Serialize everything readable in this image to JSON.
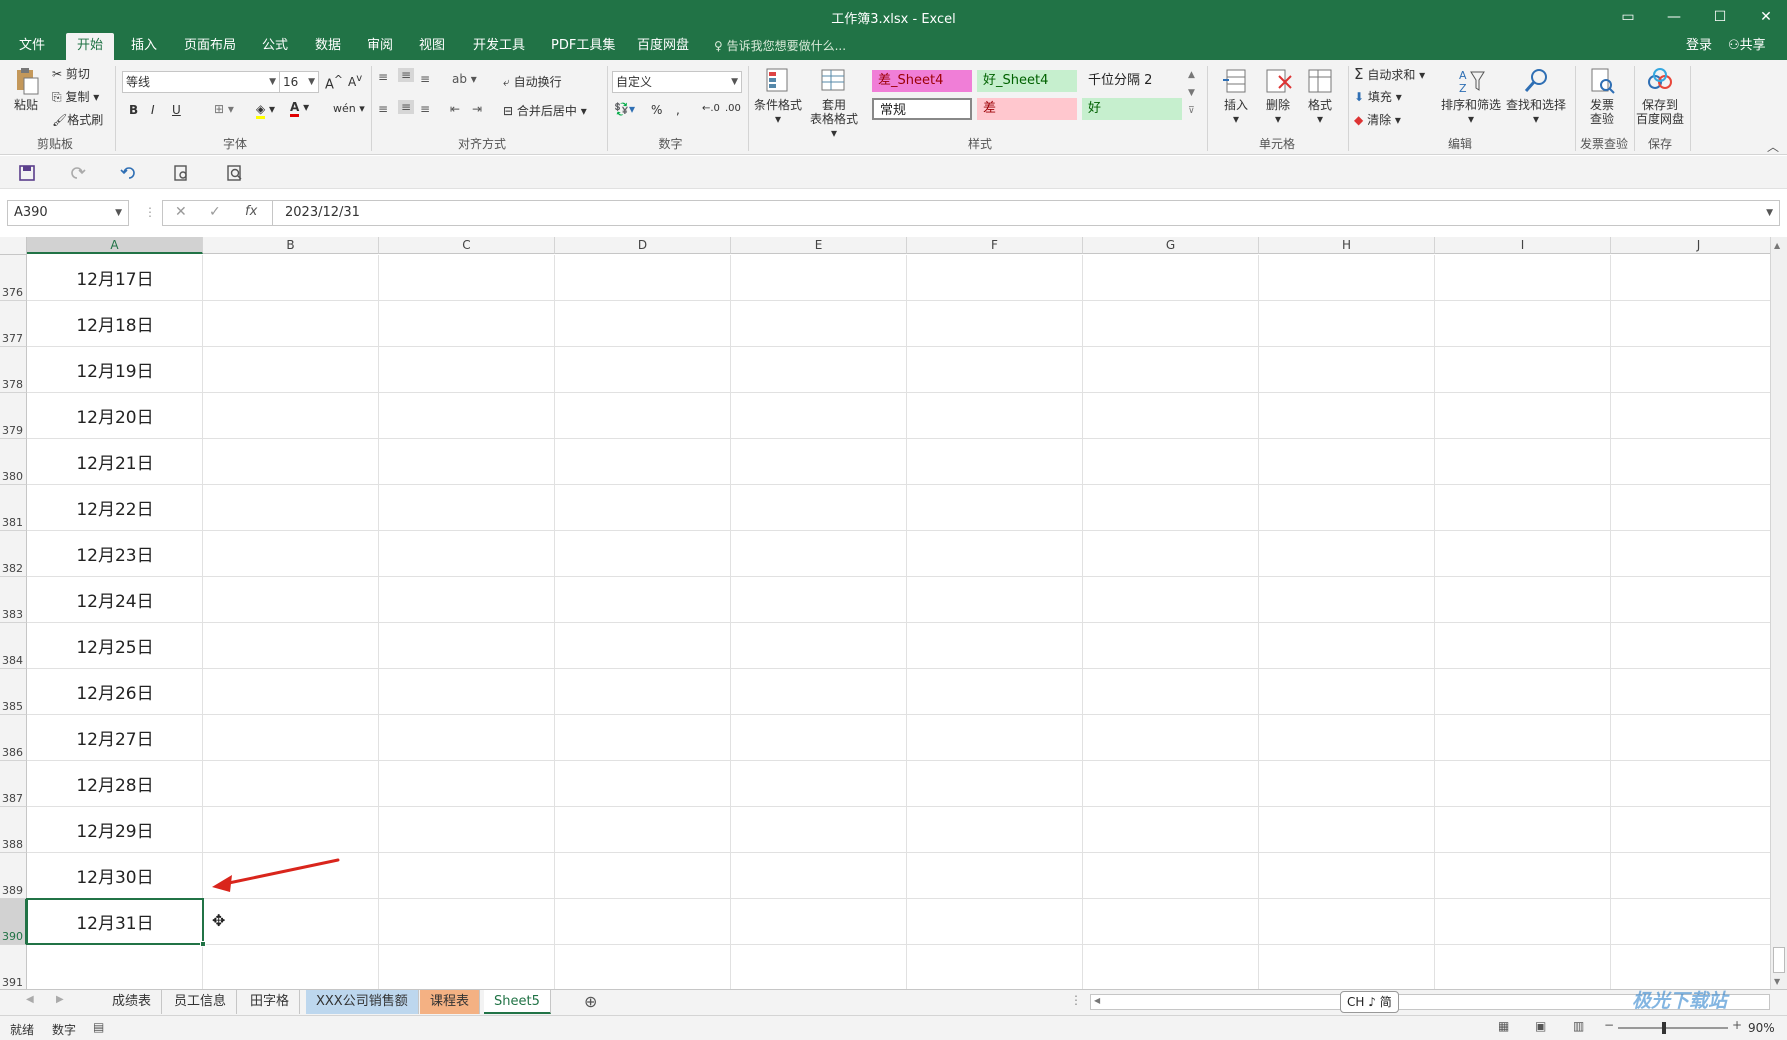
{
  "titlebar": {
    "title": "工作簿3.xlsx - Excel"
  },
  "ribbon_tabs": {
    "file": "文件",
    "home": "开始",
    "insert": "插入",
    "page_layout": "页面布局",
    "formulas": "公式",
    "data": "数据",
    "review": "审阅",
    "view": "视图",
    "developer": "开发工具",
    "pdf": "PDF工具集",
    "baidu": "百度网盘",
    "tell_me": "告诉我您想要做什么...",
    "login": "登录",
    "share": "共享"
  },
  "clipboard": {
    "paste": "粘贴",
    "cut": "剪切",
    "copy": "复制",
    "format_painter": "格式刷",
    "label": "剪贴板"
  },
  "font": {
    "name": "等线",
    "size": "16",
    "bold": "B",
    "italic": "I",
    "underline": "U",
    "label": "字体"
  },
  "alignment": {
    "wrap": "自动换行",
    "merge": "合并后居中",
    "label": "对齐方式"
  },
  "number": {
    "format": "自定义",
    "label": "数字"
  },
  "styles": {
    "conditional": "条件格式",
    "table_line1": "套用",
    "table_line2": "表格格式",
    "cells": [
      "差_Sheet4",
      "好_Sheet4",
      "千位分隔 2",
      "常规",
      "差",
      "好"
    ],
    "label": "样式"
  },
  "cells_group": {
    "insert": "插入",
    "delete": "删除",
    "format": "格式",
    "label": "单元格"
  },
  "editing": {
    "autosum": "自动求和",
    "fill": "填充",
    "clear": "清除",
    "sort_line1": "排序和筛选",
    "find_line1": "查找和选择",
    "label": "编辑"
  },
  "invoice": {
    "line1": "发票",
    "line2": "查验",
    "label": "发票查验"
  },
  "save_group": {
    "line1": "保存到",
    "line2": "百度网盘",
    "label": "保存"
  },
  "formula_bar": {
    "name_box": "A390",
    "formula": "2023/12/31"
  },
  "columns": [
    "A",
    "B",
    "C",
    "D",
    "E",
    "F",
    "G",
    "H",
    "I",
    "J"
  ],
  "rows": [
    {
      "num": "376",
      "value": "12月17日"
    },
    {
      "num": "377",
      "value": "12月18日"
    },
    {
      "num": "378",
      "value": "12月19日"
    },
    {
      "num": "379",
      "value": "12月20日"
    },
    {
      "num": "380",
      "value": "12月21日"
    },
    {
      "num": "381",
      "value": "12月22日"
    },
    {
      "num": "382",
      "value": "12月23日"
    },
    {
      "num": "383",
      "value": "12月24日"
    },
    {
      "num": "384",
      "value": "12月25日"
    },
    {
      "num": "385",
      "value": "12月26日"
    },
    {
      "num": "386",
      "value": "12月27日"
    },
    {
      "num": "387",
      "value": "12月28日"
    },
    {
      "num": "388",
      "value": "12月29日"
    },
    {
      "num": "389",
      "value": "12月30日"
    },
    {
      "num": "390",
      "value": "12月31日"
    },
    {
      "num": "391",
      "value": ""
    }
  ],
  "sheets": [
    "成绩表",
    "员工信息",
    "田字格",
    "XXX公司销售额",
    "课程表",
    "Sheet5"
  ],
  "sheet_colors": {
    "XXX公司销售额": "#bdd7ee",
    "课程表": "#f4b183"
  },
  "ime": "CH ♪ 简",
  "status": {
    "ready": "就绪",
    "mode": "数字",
    "zoom": "90%"
  },
  "watermark": "极光下载站",
  "colors": {
    "accent": "#217346",
    "arrow": "#d9251c"
  }
}
